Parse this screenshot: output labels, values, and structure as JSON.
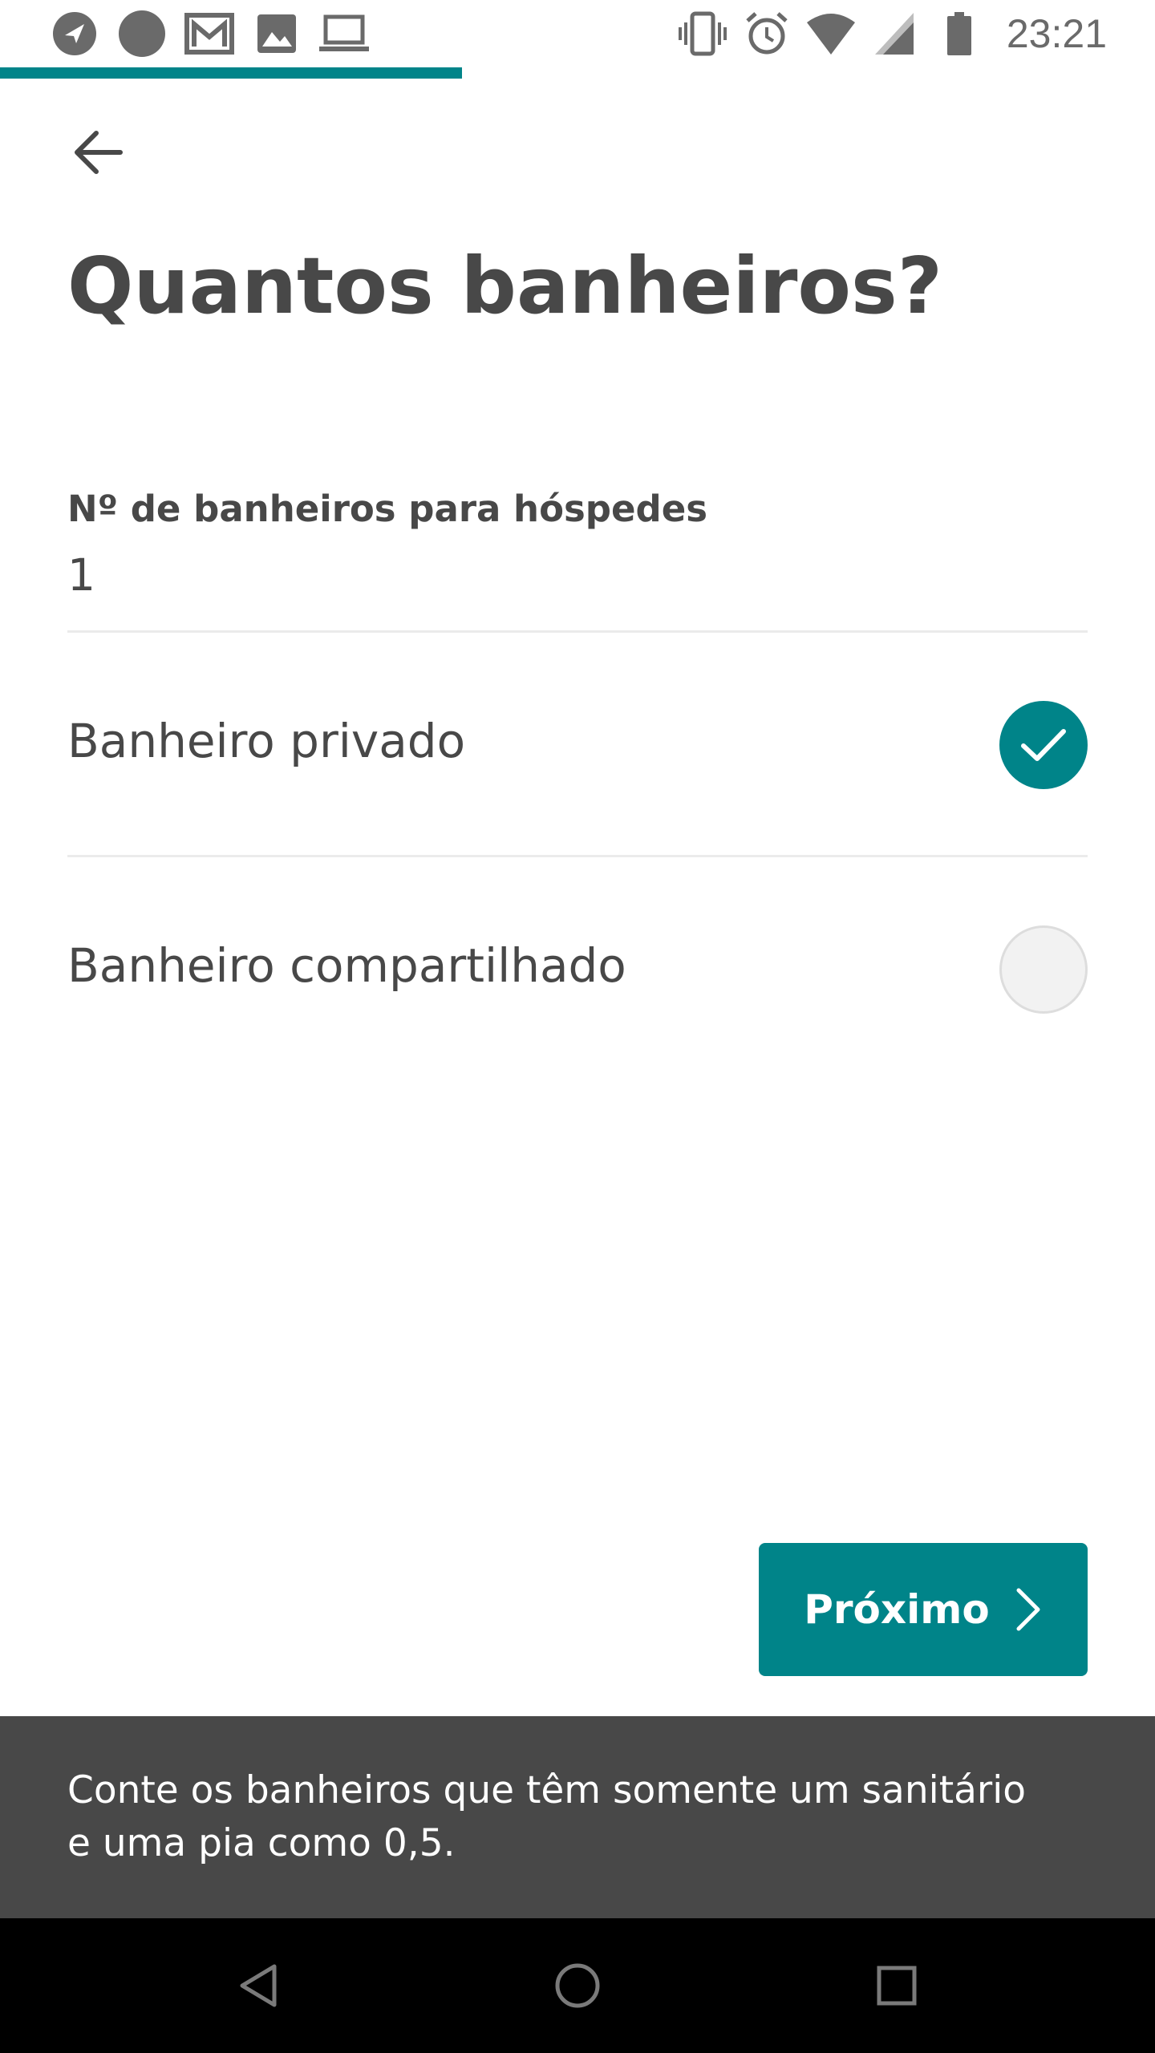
{
  "status_bar": {
    "time": "23:21",
    "left_icons": [
      "navigation-icon",
      "circle-icon",
      "mail-icon",
      "image-icon",
      "laptop-icon"
    ],
    "right_icons": [
      "vibrate-icon",
      "alarm-icon",
      "wifi-icon",
      "signal-icon",
      "battery-icon"
    ]
  },
  "progress": {
    "fraction": 0.4
  },
  "header": {
    "back_icon": "arrow-left-icon"
  },
  "page": {
    "title": "Quantos banheiros?"
  },
  "bathrooms_field": {
    "label": "Nº de banheiros para hóspedes",
    "value": "1"
  },
  "options": [
    {
      "label": "Banheiro privado",
      "selected": true
    },
    {
      "label": "Banheiro compartilhado",
      "selected": false
    }
  ],
  "next_button": {
    "label": "Próximo",
    "icon": "chevron-right-icon"
  },
  "snackbar": {
    "text": "Conte os banheiros que têm somente um sanitário e uma pia como 0,5."
  },
  "nav_bar": {
    "buttons": [
      "back-triangle-icon",
      "home-circle-icon",
      "recents-square-icon"
    ]
  },
  "colors": {
    "accent": "#008489",
    "text": "#484848",
    "snackbar": "#484848",
    "divider": "#ebebeb"
  }
}
